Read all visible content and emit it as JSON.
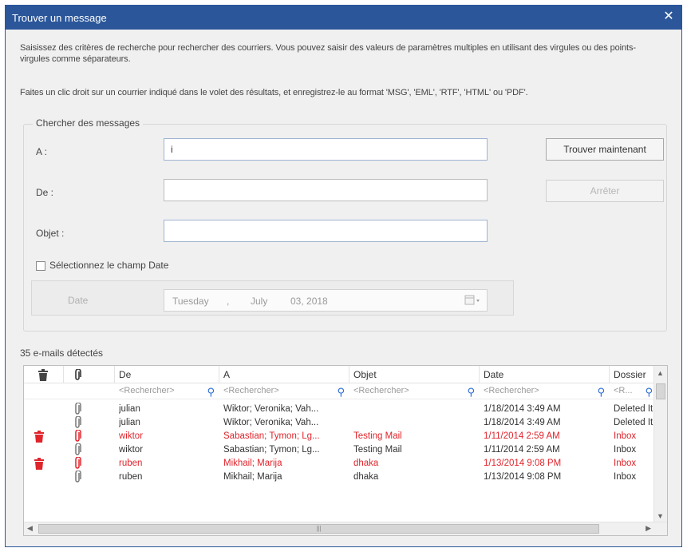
{
  "dialog": {
    "title": "Trouver un message",
    "close_glyph": "✕",
    "description_1": "Saisissez des critères de recherche pour rechercher des courriers. Vous pouvez saisir des valeurs de paramètres multiples en utilisant des virgules ou des points-virgules comme séparateurs.",
    "description_2": "Faites un clic droit sur un courrier indiqué dans le volet des résultats, et enregistrez-le au format 'MSG', 'EML', 'RTF', 'HTML' ou 'PDF'."
  },
  "search": {
    "group_label": "Chercher des messages",
    "to_label": "A :",
    "to_value": "i",
    "from_label": "De :",
    "from_value": "",
    "subject_label": "Objet :",
    "subject_value": "",
    "find_button": "Trouver maintenant",
    "stop_button": "Arrêter",
    "date_checkbox_label": "Sélectionnez le champ Date",
    "date_checked": false,
    "date_label": "Date",
    "date_weekday": "Tuesday",
    "date_sep1": ",",
    "date_month": "July",
    "date_day_year": "03, 2018",
    "date_button_icon": "calendar-dropdown-icon"
  },
  "results": {
    "count_text": "35 e-mails détectés",
    "header_icons": {
      "trash": "trash-icon",
      "attachment": "attachment-icon"
    },
    "columns": [
      "De",
      "A",
      "Objet",
      "Date",
      "Dossier"
    ],
    "filter_placeholders": [
      "<Rechercher>",
      "<Rechercher>",
      "<Rechercher>",
      "<Rechercher>",
      "<R..."
    ],
    "rows": [
      {
        "deleted": false,
        "from": "julian",
        "to": "Wiktor; Veronika; Vah...",
        "subject": "",
        "date": "1/18/2014 3:49 AM",
        "folder": "Deleted It",
        "highlight": false
      },
      {
        "deleted": false,
        "from": "julian",
        "to": "Wiktor; Veronika; Vah...",
        "subject": "",
        "date": "1/18/2014 3:49 AM",
        "folder": "Deleted It",
        "highlight": false
      },
      {
        "deleted": true,
        "from": "wiktor",
        "to": "Sabastian; Tymon; Lg...",
        "subject": "Testing Mail",
        "date": "1/11/2014 2:59 AM",
        "folder": "Inbox",
        "highlight": true
      },
      {
        "deleted": false,
        "from": "wiktor",
        "to": "Sabastian; Tymon; Lg...",
        "subject": "Testing Mail",
        "date": "1/11/2014 2:59 AM",
        "folder": "Inbox",
        "highlight": false
      },
      {
        "deleted": true,
        "from": "ruben",
        "to": "Mikhail; Marija",
        "subject": "dhaka",
        "date": "1/13/2014 9:08 PM",
        "folder": "Inbox",
        "highlight": true
      },
      {
        "deleted": false,
        "from": "ruben",
        "to": "Mikhail; Marija",
        "subject": "dhaka",
        "date": "1/13/2014 9:08 PM",
        "folder": "Inbox",
        "highlight": false
      }
    ],
    "colors": {
      "highlight": "#e0242b",
      "accent": "#2b579a",
      "search_icon": "#2b6cd6"
    }
  }
}
